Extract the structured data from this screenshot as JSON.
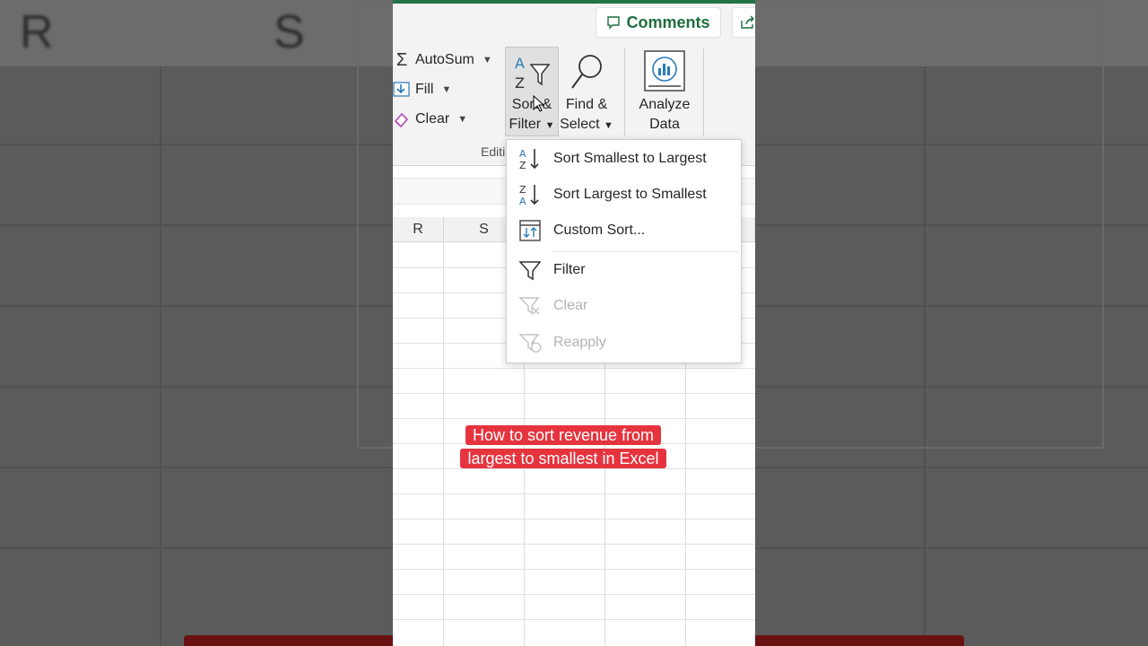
{
  "background": {
    "col_letters": [
      "R",
      "S"
    ]
  },
  "ribbon": {
    "comments_label": "Comments",
    "autosum_label": "AutoSum",
    "fill_label": "Fill",
    "clear_label": "Clear",
    "sort_filter": {
      "line1": "Sort &",
      "line2": "Filter"
    },
    "find_select": {
      "line1": "Find &",
      "line2": "Select"
    },
    "analyze_data": {
      "line1": "Analyze",
      "line2": "Data"
    },
    "group_label": "Editi"
  },
  "sheet": {
    "columns": [
      "R",
      "S",
      "",
      "",
      ""
    ]
  },
  "sort_menu": {
    "items": [
      {
        "label": "Sort Smallest to Largest",
        "icon": "sort-az-icon",
        "enabled": true
      },
      {
        "label": "Sort Largest to Smallest",
        "icon": "sort-za-icon",
        "enabled": true
      },
      {
        "label": "Custom Sort...",
        "icon": "custom-sort-icon",
        "enabled": true
      },
      {
        "label": "Filter",
        "icon": "filter-icon",
        "enabled": true
      },
      {
        "label": "Clear",
        "icon": "clear-filter-icon",
        "enabled": false
      },
      {
        "label": "Reapply",
        "icon": "reapply-filter-icon",
        "enabled": false
      }
    ]
  },
  "caption": {
    "text": "How to sort revenue from largest to smallest in Excel"
  },
  "colors": {
    "excel_green": "#217346",
    "caption_red": "#e5343e"
  }
}
